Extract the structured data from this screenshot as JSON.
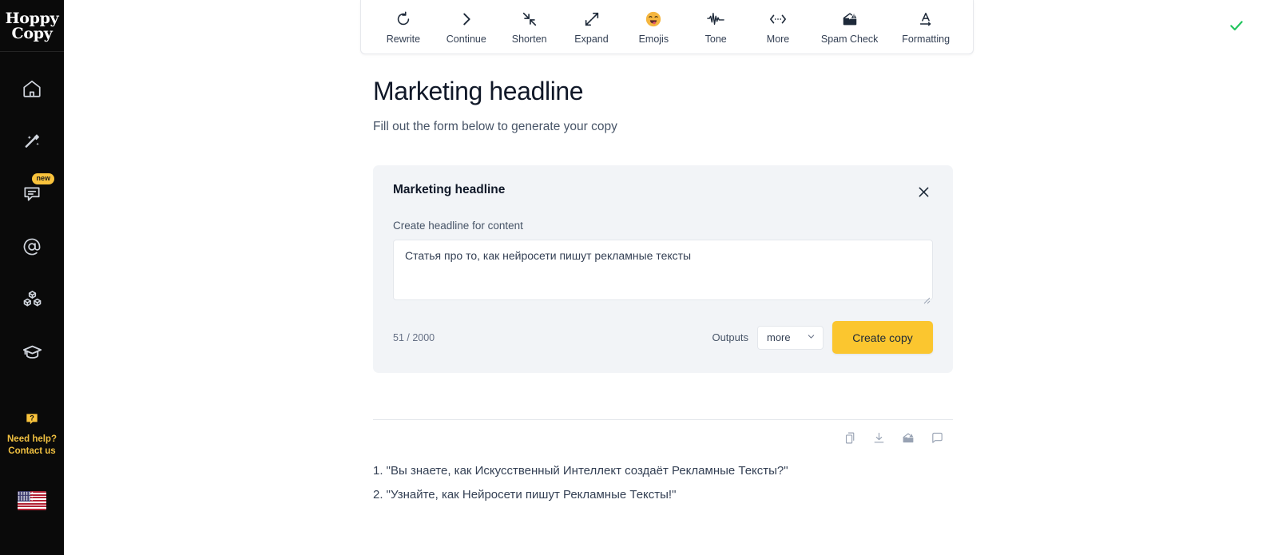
{
  "brand": {
    "line1": "Hoppy",
    "line2": "Copy"
  },
  "sidebar": {
    "items": [
      {
        "icon": "home-icon",
        "name": "home",
        "badge": ""
      },
      {
        "icon": "magic-wand-icon",
        "name": "ai-tools",
        "badge": ""
      },
      {
        "icon": "chat-bubble-icon",
        "name": "chat",
        "badge": "new"
      },
      {
        "icon": "at-sign-icon",
        "name": "email",
        "badge": ""
      },
      {
        "icon": "blocks-icon",
        "name": "templates",
        "badge": ""
      },
      {
        "icon": "graduation-cap-icon",
        "name": "academy",
        "badge": ""
      }
    ],
    "help": {
      "line1": "Need help?",
      "line2": "Contact us",
      "icon": "question-bubble-icon"
    },
    "language": {
      "flag": "us-flag",
      "label": "English"
    }
  },
  "toolbar": {
    "items": [
      {
        "label": "Rewrite",
        "icon": "rotate-icon"
      },
      {
        "label": "Continue",
        "icon": "chevron-right-icon"
      },
      {
        "label": "Shorten",
        "icon": "arrows-in-icon"
      },
      {
        "label": "Expand",
        "icon": "arrows-out-icon"
      },
      {
        "label": "Emojis",
        "icon": "emoji-icon"
      },
      {
        "label": "Tone",
        "icon": "waveform-icon"
      },
      {
        "label": "More",
        "icon": "ellipsis-arrows-icon"
      },
      {
        "label": "Spam Check",
        "icon": "spam-envelope-icon"
      },
      {
        "label": "Formatting",
        "icon": "text-format-icon"
      }
    ],
    "status_icon": "green-check-icon",
    "status_color": "#22c55e"
  },
  "main": {
    "title": "Marketing headline",
    "subtitle": "Fill out the form below to generate your copy"
  },
  "card": {
    "title": "Marketing headline",
    "close_icon": "close-icon",
    "field_label": "Create headline for content",
    "textarea_value": "Статья про то, как нейросети пишут рекламные тексты",
    "textarea_placeholder": "Create headline for content",
    "counter": "51 / 2000",
    "outputs_label": "Outputs",
    "outputs_value": "more",
    "submit_label": "Create copy",
    "accent_color": "#fbc62f"
  },
  "results": {
    "actions": [
      {
        "icon": "copy-icon",
        "name": "copy"
      },
      {
        "icon": "download-icon",
        "name": "download"
      },
      {
        "icon": "spam-envelope-icon",
        "name": "spam-check"
      },
      {
        "icon": "comment-icon",
        "name": "comment"
      }
    ],
    "lines": [
      "1. \"Вы знаете, как Искусственный Интеллект создаёт Рекламные Тексты?\"",
      "2. \"Узнайте, как Нейросети пишут Рекламные Тексты!\""
    ]
  }
}
